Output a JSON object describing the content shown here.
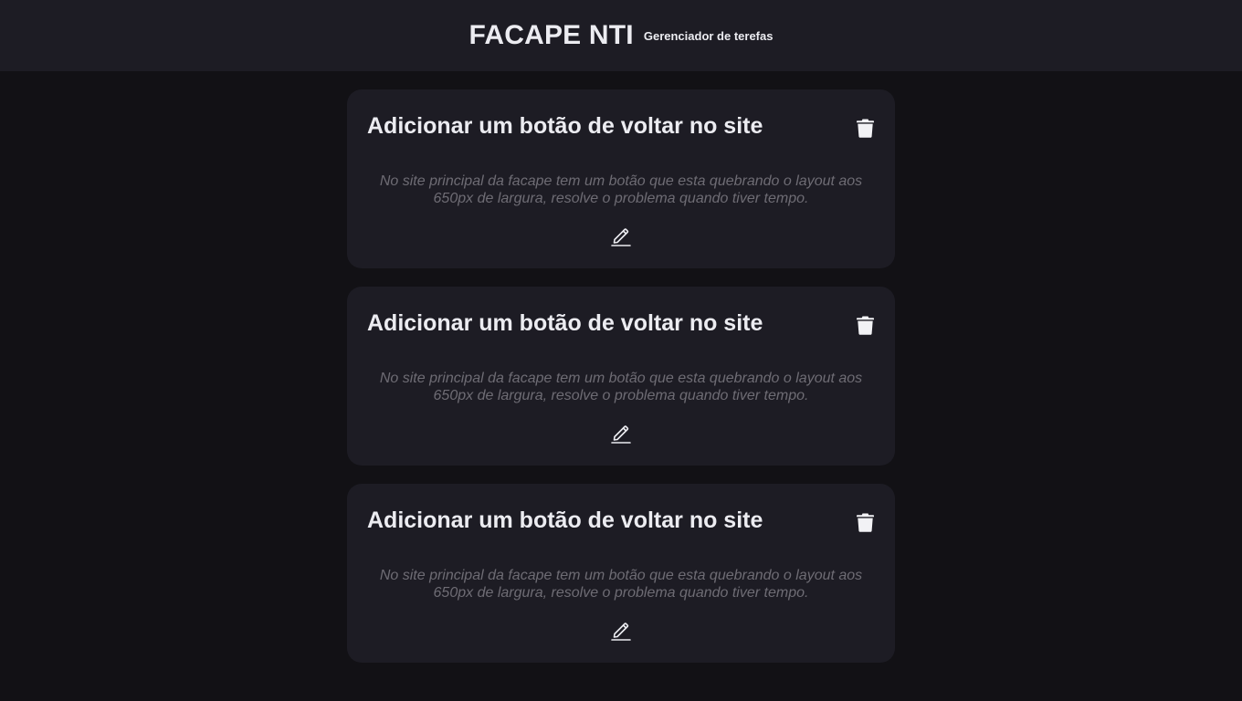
{
  "header": {
    "title": "FACAPE NTI",
    "subtitle": "Gerenciador de terefas"
  },
  "tasks": [
    {
      "title": "Adicionar um botão de voltar no site",
      "description": "No site principal da facape tem um botão que esta quebrando o layout aos 650px de largura, resolve o problema quando tiver tempo.",
      "delete_icon": "trash-icon",
      "edit_icon": "pencil-icon"
    },
    {
      "title": "Adicionar um botão de voltar no site",
      "description": "No site principal da facape tem um botão que esta quebrando o layout aos 650px de largura, resolve o problema quando tiver tempo.",
      "delete_icon": "trash-icon",
      "edit_icon": "pencil-icon"
    },
    {
      "title": "Adicionar um botão de voltar no site",
      "description": "No site principal da facape tem um botão que esta quebrando o layout aos 650px de largura, resolve o problema quando tiver tempo.",
      "delete_icon": "trash-icon",
      "edit_icon": "pencil-icon"
    }
  ],
  "colors": {
    "background": "#121115",
    "surface": "#1D1C24",
    "text": "#ECECF1",
    "muted_text": "#6E6C74"
  }
}
